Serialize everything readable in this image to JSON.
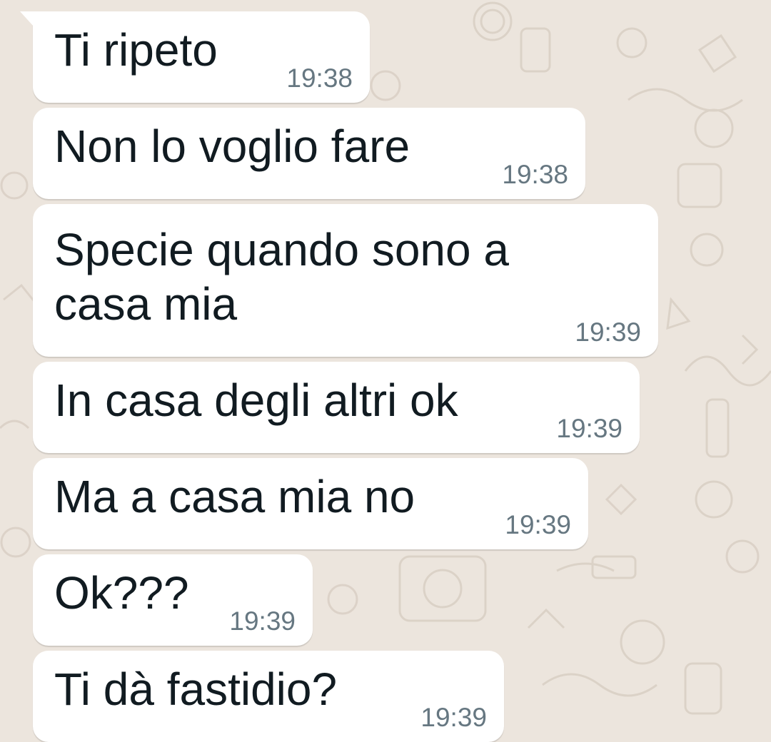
{
  "colors": {
    "background": "#ece5dd",
    "bubble": "#ffffff",
    "text": "#111b21",
    "timestamp": "#667781"
  },
  "messages": [
    {
      "text": "Ti ripeto",
      "time": "19:38"
    },
    {
      "text": "Non lo voglio fare",
      "time": "19:38"
    },
    {
      "text": "Specie quando sono a\ncasa mia",
      "time": "19:39"
    },
    {
      "text": "In casa degli altri ok",
      "time": "19:39"
    },
    {
      "text": "Ma a casa mia no",
      "time": "19:39"
    },
    {
      "text": "Ok???",
      "time": "19:39"
    },
    {
      "text": "Ti dà fastidio?",
      "time": "19:39"
    }
  ]
}
